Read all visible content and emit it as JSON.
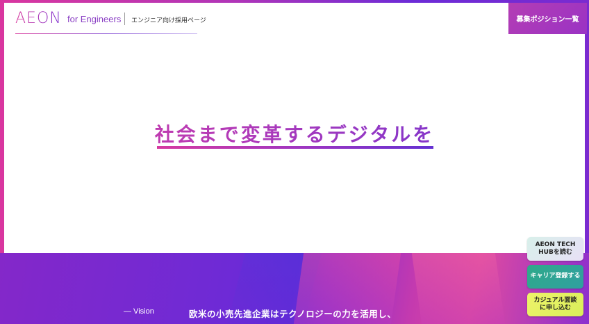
{
  "header": {
    "logo": "AEON",
    "logo_subtitle": "for Engineers",
    "tagline": "エンジニア向け採用ページ",
    "positions_button": "募集ポジション一覧"
  },
  "hero": {
    "headline": "社会まで変革するデジタルを"
  },
  "vision": {
    "label": "— Vision",
    "text": "欧米の小売先進企業はテクノロジーの力を活用し、"
  },
  "side_buttons": {
    "hub_line1": "AEON TECH",
    "hub_line2": "HUBを読む",
    "career": "キャリア登録する",
    "casual_line1": "カジュアル面談",
    "casual_line2": "に申し込む"
  },
  "colors": {
    "accent_pink": "#d63aa0",
    "accent_purple": "#6c30d2",
    "career_green": "#2fa98a",
    "casual_yellow": "#e6f263"
  }
}
